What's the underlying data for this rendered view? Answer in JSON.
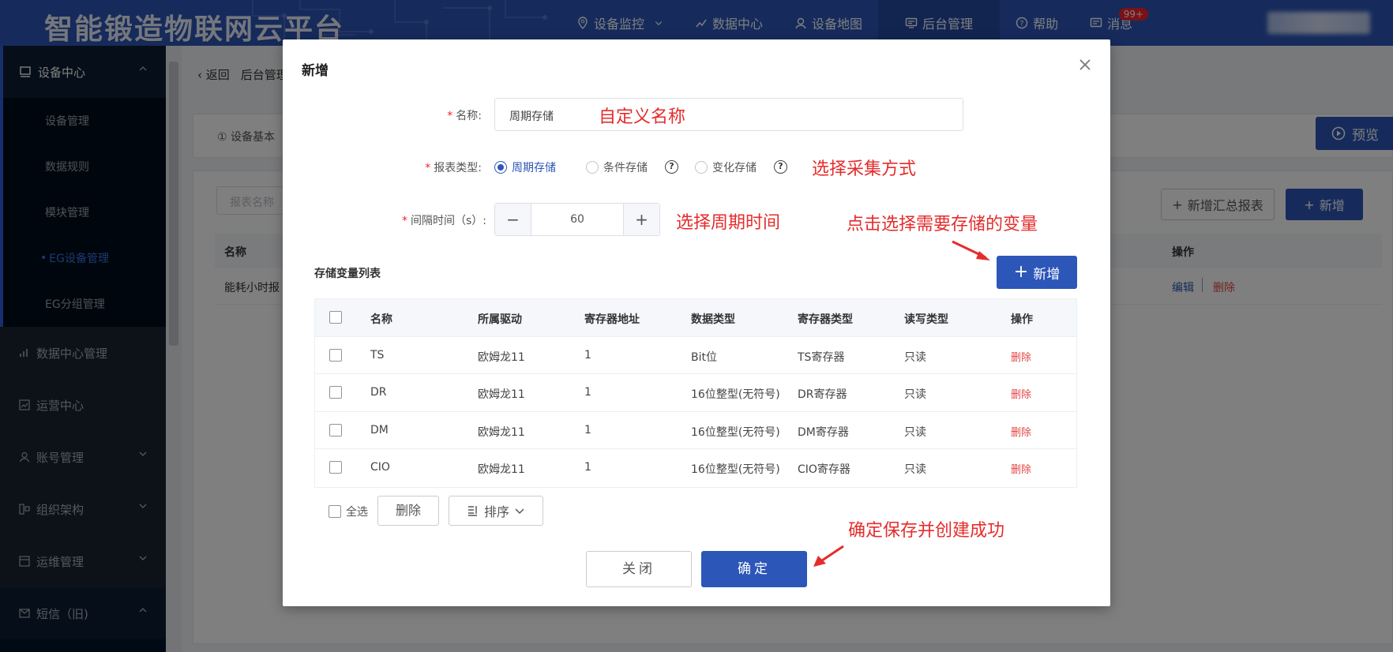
{
  "header": {
    "brand": "智能锻造物联网云平台",
    "nav": [
      {
        "label": "设备监控",
        "icon": "location-icon",
        "has_dropdown": true
      },
      {
        "label": "数据中心",
        "icon": "chart-icon"
      },
      {
        "label": "设备地图",
        "icon": "map-pin-icon"
      },
      {
        "label": "后台管理",
        "icon": "monitor-icon",
        "active": true
      },
      {
        "label": "帮助",
        "icon": "help-icon"
      },
      {
        "label": "消息",
        "icon": "message-icon",
        "badge": "99+"
      }
    ]
  },
  "sidebar": {
    "group_device": "设备中心",
    "sub_items": [
      "设备管理",
      "数据规则",
      "模块管理",
      "EG设备管理",
      "EG分组管理"
    ],
    "active_sub": "EG设备管理",
    "groups": [
      "数据中心管理",
      "运营中心",
      "账号管理",
      "组织架构",
      "运维管理",
      "短信（旧)"
    ]
  },
  "page": {
    "back": "返回",
    "crumb": "后台管理",
    "tab": "① 设备基本",
    "preview": "预览",
    "search_placeholder": "报表名称",
    "add_summary": "新增汇总报表",
    "add": "新增",
    "col_name": "名称",
    "col_ops": "操作",
    "row_name": "能耗小时报",
    "edit": "编辑",
    "delete": "删除"
  },
  "modal": {
    "title": "新增",
    "name_label": "名称:",
    "name_value": "周期存储",
    "report_type_label": "报表类型:",
    "report_types": [
      "周期存储",
      "条件存储",
      "变化存储"
    ],
    "selected_type": "周期存储",
    "interval_label": "间隔时间（s）:",
    "interval_value": "60",
    "var_list_title": "存储变量列表",
    "add_var": "新增",
    "columns": [
      "名称",
      "所属驱动",
      "寄存器地址",
      "数据类型",
      "寄存器类型",
      "读写类型",
      "操作"
    ],
    "rows": [
      {
        "name": "TS",
        "driver": "欧姆龙11",
        "addr": "1",
        "dtype": "Bit位",
        "rtype": "TS寄存器",
        "rw": "只读",
        "op": "删除"
      },
      {
        "name": "DR",
        "driver": "欧姆龙11",
        "addr": "1",
        "dtype": "16位整型(无符号)",
        "rtype": "DR寄存器",
        "rw": "只读",
        "op": "删除"
      },
      {
        "name": "DM",
        "driver": "欧姆龙11",
        "addr": "1",
        "dtype": "16位整型(无符号)",
        "rtype": "DM寄存器",
        "rw": "只读",
        "op": "删除"
      },
      {
        "name": "CIO",
        "driver": "欧姆龙11",
        "addr": "1",
        "dtype": "16位整型(无符号)",
        "rtype": "CIO寄存器",
        "rw": "只读",
        "op": "删除"
      }
    ],
    "select_all": "全选",
    "bulk_delete": "删除",
    "sort": "排序",
    "close": "关闭",
    "confirm": "确定"
  },
  "annotations": {
    "name": "自定义名称",
    "type": "选择采集方式",
    "interval": "选择周期时间",
    "add_var": "点击选择需要存储的变量",
    "confirm": "确定保存并创建成功"
  },
  "colors": {
    "primary": "#2c56b8",
    "danger": "#e54545",
    "annotation": "#e52c2c",
    "sidebar": "#001529"
  }
}
